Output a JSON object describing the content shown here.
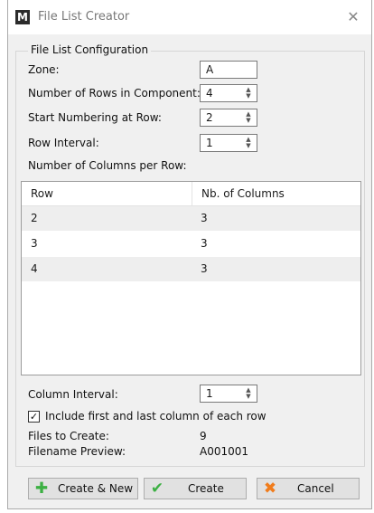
{
  "window": {
    "title": "File List Creator",
    "app_icon_letter": "M"
  },
  "group": {
    "legend": "File List Configuration"
  },
  "form": {
    "zone_label": "Zone:",
    "zone_value": "A",
    "rows_label": "Number of Rows in Component:",
    "rows_value": "4",
    "start_label": "Start Numbering at Row:",
    "start_value": "2",
    "interval_label": "Row Interval:",
    "interval_value": "1",
    "columns_per_row_label": "Number of Columns per Row:"
  },
  "table": {
    "headers": [
      "Row",
      "Nb. of Columns"
    ],
    "rows": [
      [
        "2",
        "3"
      ],
      [
        "3",
        "3"
      ],
      [
        "4",
        "3"
      ]
    ]
  },
  "column_interval": {
    "label": "Column Interval:",
    "value": "1"
  },
  "include_option": {
    "checked": true,
    "label": "Include first and last column of each row"
  },
  "summary": {
    "files_label": "Files to Create:",
    "files_value": "9",
    "preview_label": "Filename Preview:",
    "preview_value": "A001001"
  },
  "buttons": {
    "create_new": "Create & New",
    "create": "Create",
    "cancel": "Cancel"
  },
  "colors": {
    "plus_icon": "#3cb043",
    "check_icon": "#3cb043",
    "cancel_icon": "#f07c1c"
  }
}
